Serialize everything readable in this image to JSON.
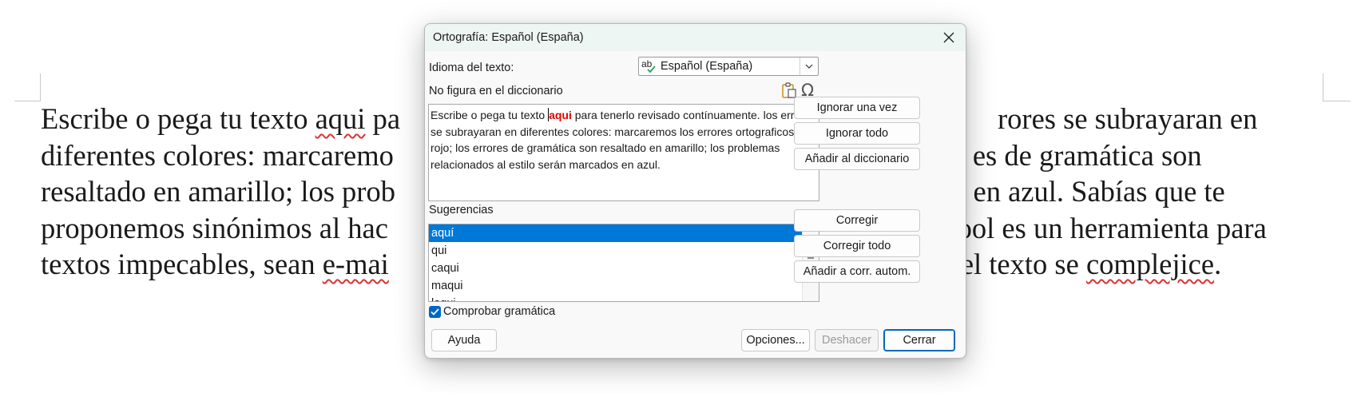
{
  "document": {
    "lines": [
      [
        "Escribe o pega tu texto ",
        "aqui",
        " pa",
        "",
        "rores se subrayaran en"
      ],
      [
        "diferentes colores: marcaremo",
        "",
        "",
        "",
        "es de gramática son"
      ],
      [
        "resaltado en amarillo; los prob",
        "",
        "",
        "",
        "os en azul. Sabías que te"
      ],
      [
        "proponemos sinónimos al hac",
        "",
        "",
        "",
        "Tool es un herramienta para"
      ],
      [
        "textos impecables, sean ",
        "e-mai",
        "",
        "",
        "el texto se ",
        "complejice",
        "."
      ]
    ]
  },
  "dialog": {
    "title": "Ortografía: Español (España)",
    "language_label": "Idioma del texto:",
    "language_value": "Español (España)",
    "not_in_dict_label": "No figura en el diccionario",
    "text_before": "Escribe o pega tu texto ",
    "text_error": "aqui",
    "text_after": " para tenerlo revisado contínuamente. los errores se subrayaran en diferentes colores: marcaremos los errores ortograficos en rojo; los errores de gramática son resaltado en amarillo; los problemas relacionados al estilo serán marcados en azul.",
    "suggestions_label": "Sugerencias",
    "suggestions": [
      "aquí",
      "qui",
      "caqui",
      "maqui",
      "laqui"
    ],
    "check_grammar_label": "Comprobar gramática",
    "check_grammar_checked": true,
    "buttons": {
      "ignore_once": "Ignorar una vez",
      "ignore_all": "Ignorar todo",
      "add_dict": "Añadir al diccionario",
      "correct": "Corregir",
      "correct_all": "Corregir todo",
      "add_autocorrect": "Añadir a corr. autom.",
      "help": "Ayuda",
      "options": "Opciones...",
      "undo": "Deshacer",
      "close": "Cerrar"
    }
  },
  "colors": {
    "accent": "#0067c0",
    "selection": "#0078d7",
    "error_text": "#e00000",
    "title_bar": "#eef6f4"
  }
}
